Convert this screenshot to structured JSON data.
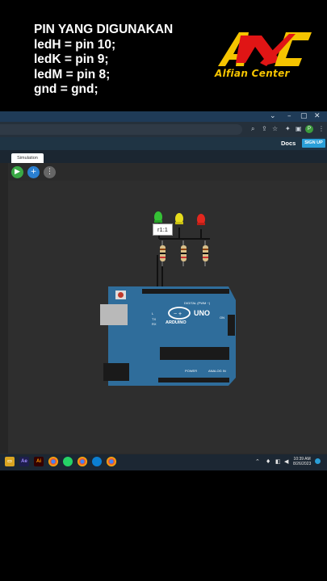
{
  "caption": {
    "lines": [
      "PIN YANG DIGUNAKAN",
      "ledH = pin 10;",
      "ledK = pin 9;",
      "ledM = pin 8;",
      "gnd = gnd;"
    ]
  },
  "logo": {
    "text": "Alfian Center",
    "colors": {
      "red": "#e01515",
      "yellow": "#f5c400"
    }
  },
  "browser": {
    "window_controls": [
      "⌄",
      "–",
      "▢",
      "✕"
    ],
    "appbar": {
      "docs_label": "Docs",
      "signup_label": "SIGN UP"
    },
    "tab_label": "Simulation",
    "toolbar": {
      "play_icon": "▶",
      "add_icon": "+",
      "more_icon": "⋮"
    }
  },
  "simulator": {
    "tooltip": "r1:1",
    "leds": [
      {
        "color": "green",
        "hex": "#35c135"
      },
      {
        "color": "yellow",
        "hex": "#e6dc1c"
      },
      {
        "color": "red",
        "hex": "#e2271e"
      }
    ],
    "board": {
      "model": "UNO",
      "brand": "ARDUINO",
      "digital_label": "DIGITAL (PWM ~)",
      "analog_label": "ANALOG IN",
      "power_label": "POWER",
      "on_label": "ON"
    }
  },
  "taskbar": {
    "time": "10:39 AM",
    "date": "8/26/2023",
    "apps": [
      "Ae",
      "Ai",
      "Chrome",
      "WhatsApp",
      "Edge",
      "Chrome2"
    ]
  },
  "colors": {
    "board": "#2f6d9b",
    "accent_blue": "#2a9fd8",
    "play_green": "#3aa845"
  }
}
